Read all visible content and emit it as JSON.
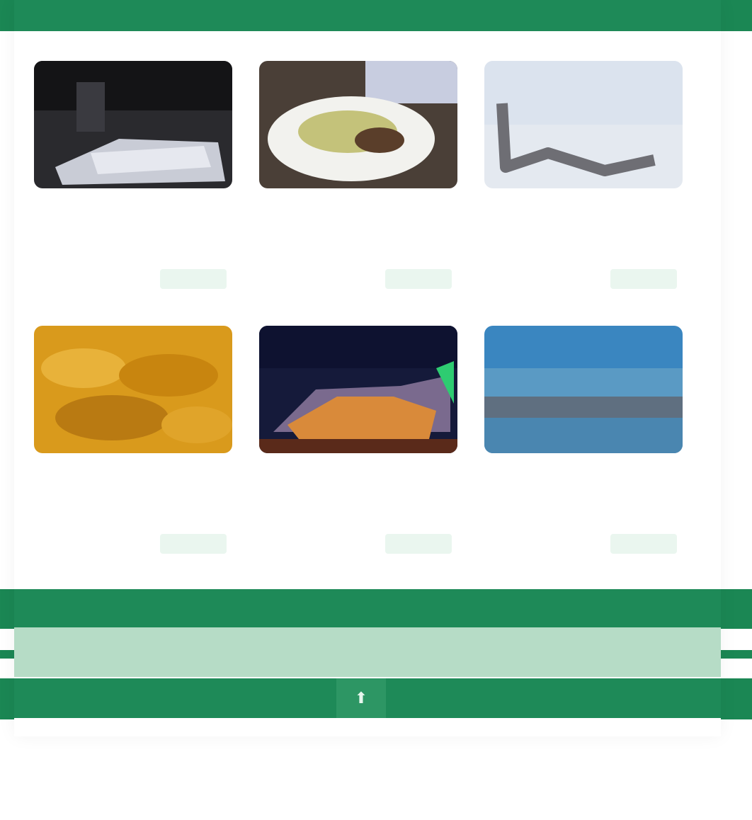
{
  "header": {
    "tabs": [
      {
        "label": ""
      },
      {
        "label": ""
      }
    ]
  },
  "cards": [
    {
      "title": "",
      "meta": "",
      "button": "",
      "image_icon": "hotel-bed-image"
    },
    {
      "title": "",
      "meta": "",
      "button": "",
      "image_icon": "food-plate-image"
    },
    {
      "title": "",
      "meta": "",
      "button": "",
      "image_icon": "lounge-chair-image"
    },
    {
      "title": "",
      "meta": "",
      "button": "",
      "image_icon": "fried-food-image"
    },
    {
      "title": "",
      "meta": "",
      "button": "",
      "image_icon": "night-stadium-image"
    },
    {
      "title": "",
      "meta": "",
      "button": "",
      "image_icon": "seascape-image"
    }
  ],
  "footer": {
    "link": ""
  },
  "scroll_top": {
    "icon": "arrow-up-icon",
    "glyph": "⬆"
  },
  "brand": {
    "logo": ""
  },
  "colors": {
    "accent": "#1b8754",
    "accent_light": "#b6dcc6",
    "button_bg": "#eaf6ef"
  }
}
